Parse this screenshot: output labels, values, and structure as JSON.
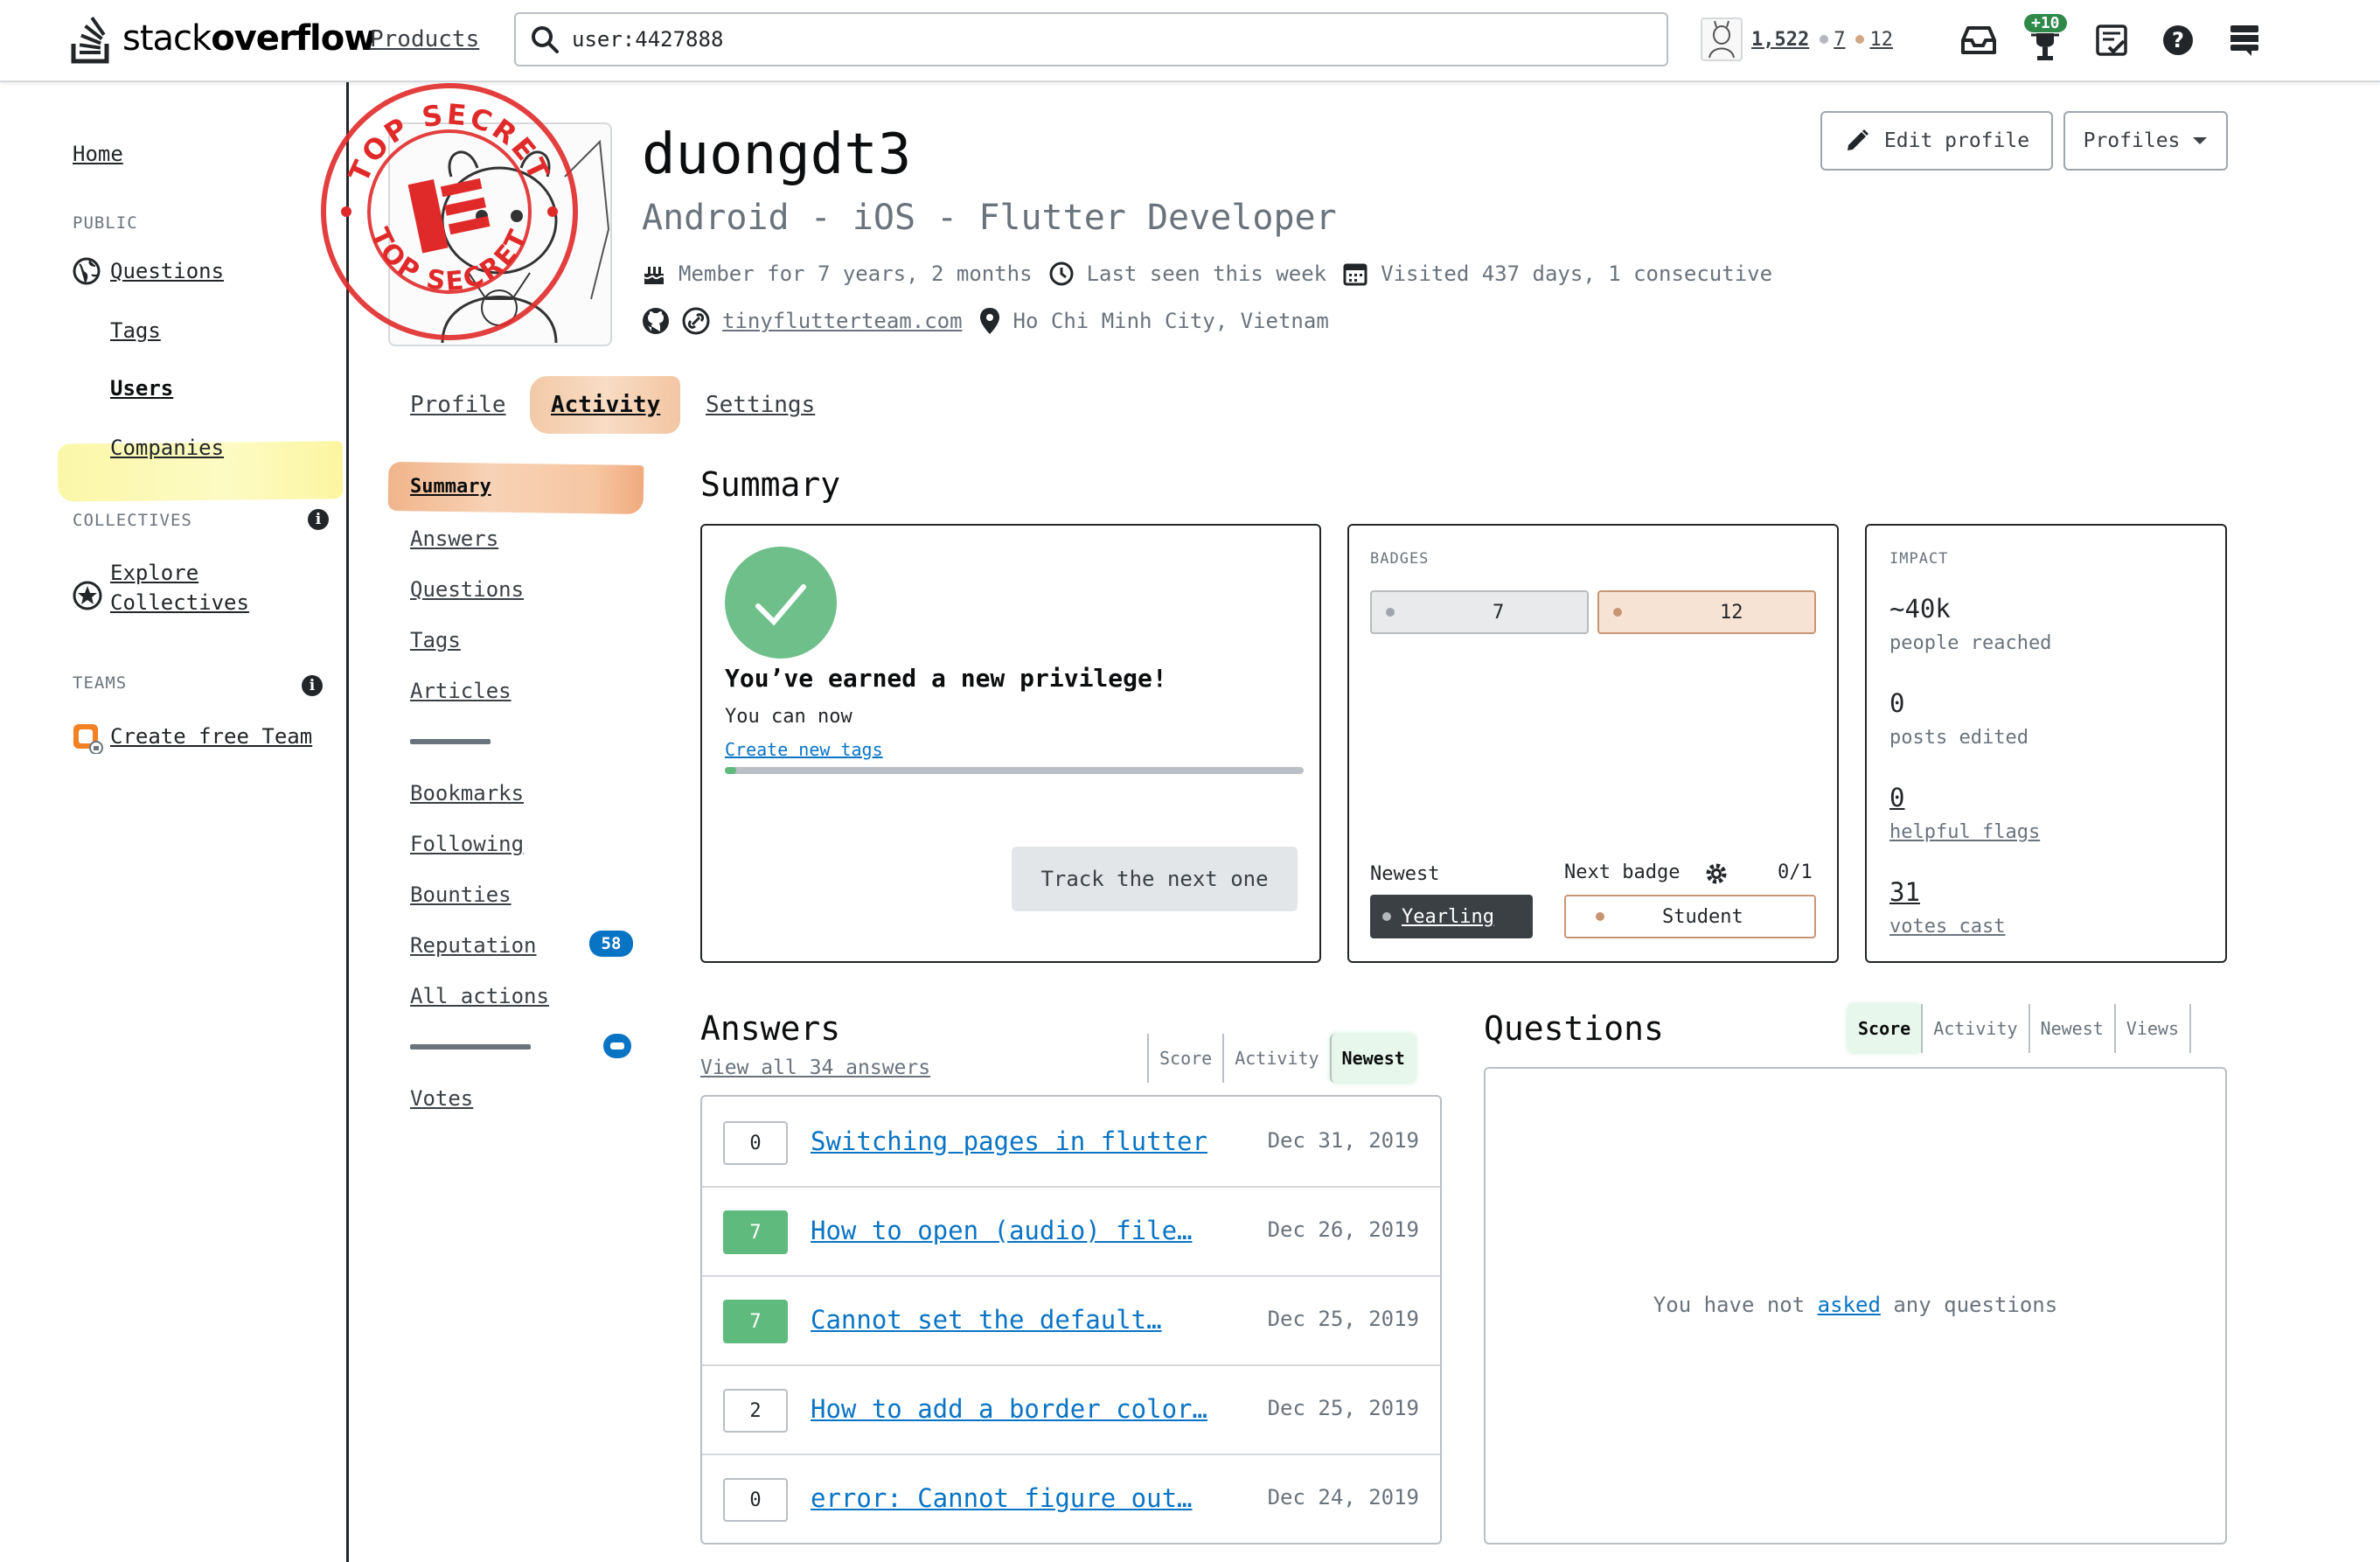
{
  "header": {
    "logo_text_light": "stack",
    "logo_text_bold": "overflow",
    "products_label": "Products",
    "search_value": "user:4427888",
    "reputation": "1,522",
    "silver_badges": "7",
    "bronze_badges": "12",
    "achievements_delta": "+10"
  },
  "sidebar": {
    "home": "Home",
    "public_heading": "PUBLIC",
    "questions": "Questions",
    "tags": "Tags",
    "users": "Users",
    "companies": "Companies",
    "collectives_heading": "COLLECTIVES",
    "explore_line1": "Explore",
    "explore_line2": "Collectives",
    "teams_heading": "TEAMS",
    "create_team": "Create free Team"
  },
  "profile": {
    "stamp_text": "TOP SECRET",
    "username": "duongdt3",
    "title": "Android - iOS - Flutter Developer",
    "member_for": "Member for 7 years, 2 months",
    "last_seen": "Last seen this week",
    "visited": "Visited 437 days, 1 consecutive",
    "website": "tinyflutterteam.com",
    "location": "Ho Chi Minh City, Vietnam",
    "edit_profile": "Edit profile",
    "profiles": "Profiles"
  },
  "tabs": {
    "profile": "Profile",
    "activity": "Activity",
    "settings": "Settings"
  },
  "subnav": {
    "summary": "Summary",
    "answers": "Answers",
    "questions": "Questions",
    "tags": "Tags",
    "articles": "Articles",
    "bookmarks": "Bookmarks",
    "following": "Following",
    "bounties": "Bounties",
    "reputation": "Reputation",
    "reputation_count": "58",
    "all_actions": "All actions",
    "votes": "Votes"
  },
  "summary": {
    "heading": "Summary",
    "privilege": {
      "title": "You’ve earned a new privilege!",
      "you_can_now": "You can now",
      "link": "Create new tags",
      "progress": 0.02,
      "track_button": "Track the next one"
    },
    "badges": {
      "caption": "BADGES",
      "silver_count": "7",
      "bronze_count": "12",
      "newest_label": "Newest",
      "newest_badge": "Yearling",
      "next_label": "Next badge",
      "next_progress": "0/1",
      "next_badge": "Student"
    },
    "impact": {
      "caption": "IMPACT",
      "reached_value": "~40k",
      "reached_label": "people reached",
      "edited_value": "0",
      "edited_label": "posts edited",
      "flags_value": "0",
      "flags_label": "helpful flags",
      "votes_value": "31",
      "votes_label": "votes cast"
    }
  },
  "answers": {
    "heading": "Answers",
    "view_all": "View all 34 answers",
    "sort": [
      "Score",
      "Activity",
      "Newest"
    ],
    "active_sort": "Newest",
    "items": [
      {
        "score": "0",
        "accepted": false,
        "title": "Switching pages in flutter",
        "date": "Dec 31, 2019"
      },
      {
        "score": "7",
        "accepted": true,
        "title": "How to open (audio) file…",
        "date": "Dec 26, 2019"
      },
      {
        "score": "7",
        "accepted": true,
        "title": "Cannot set the default…",
        "date": "Dec 25, 2019"
      },
      {
        "score": "2",
        "accepted": false,
        "title": "How to add a border color…",
        "date": "Dec 25, 2019"
      },
      {
        "score": "0",
        "accepted": false,
        "title": "error: Cannot figure out…",
        "date": "Dec 24, 2019"
      }
    ]
  },
  "questions": {
    "heading": "Questions",
    "sort": [
      "Score",
      "Activity",
      "Newest",
      "Views"
    ],
    "active_sort": "Score",
    "empty_prefix": "You have not",
    "empty_link": "asked",
    "empty_suffix": "any questions"
  },
  "colors": {
    "accent_blue": "#0a74c4",
    "accepted_green": "#5eba7d",
    "stamp_red": "#e02a2a",
    "highlight_yellow": "#fbf7a8",
    "highlight_orange": "#f2c9a7"
  }
}
